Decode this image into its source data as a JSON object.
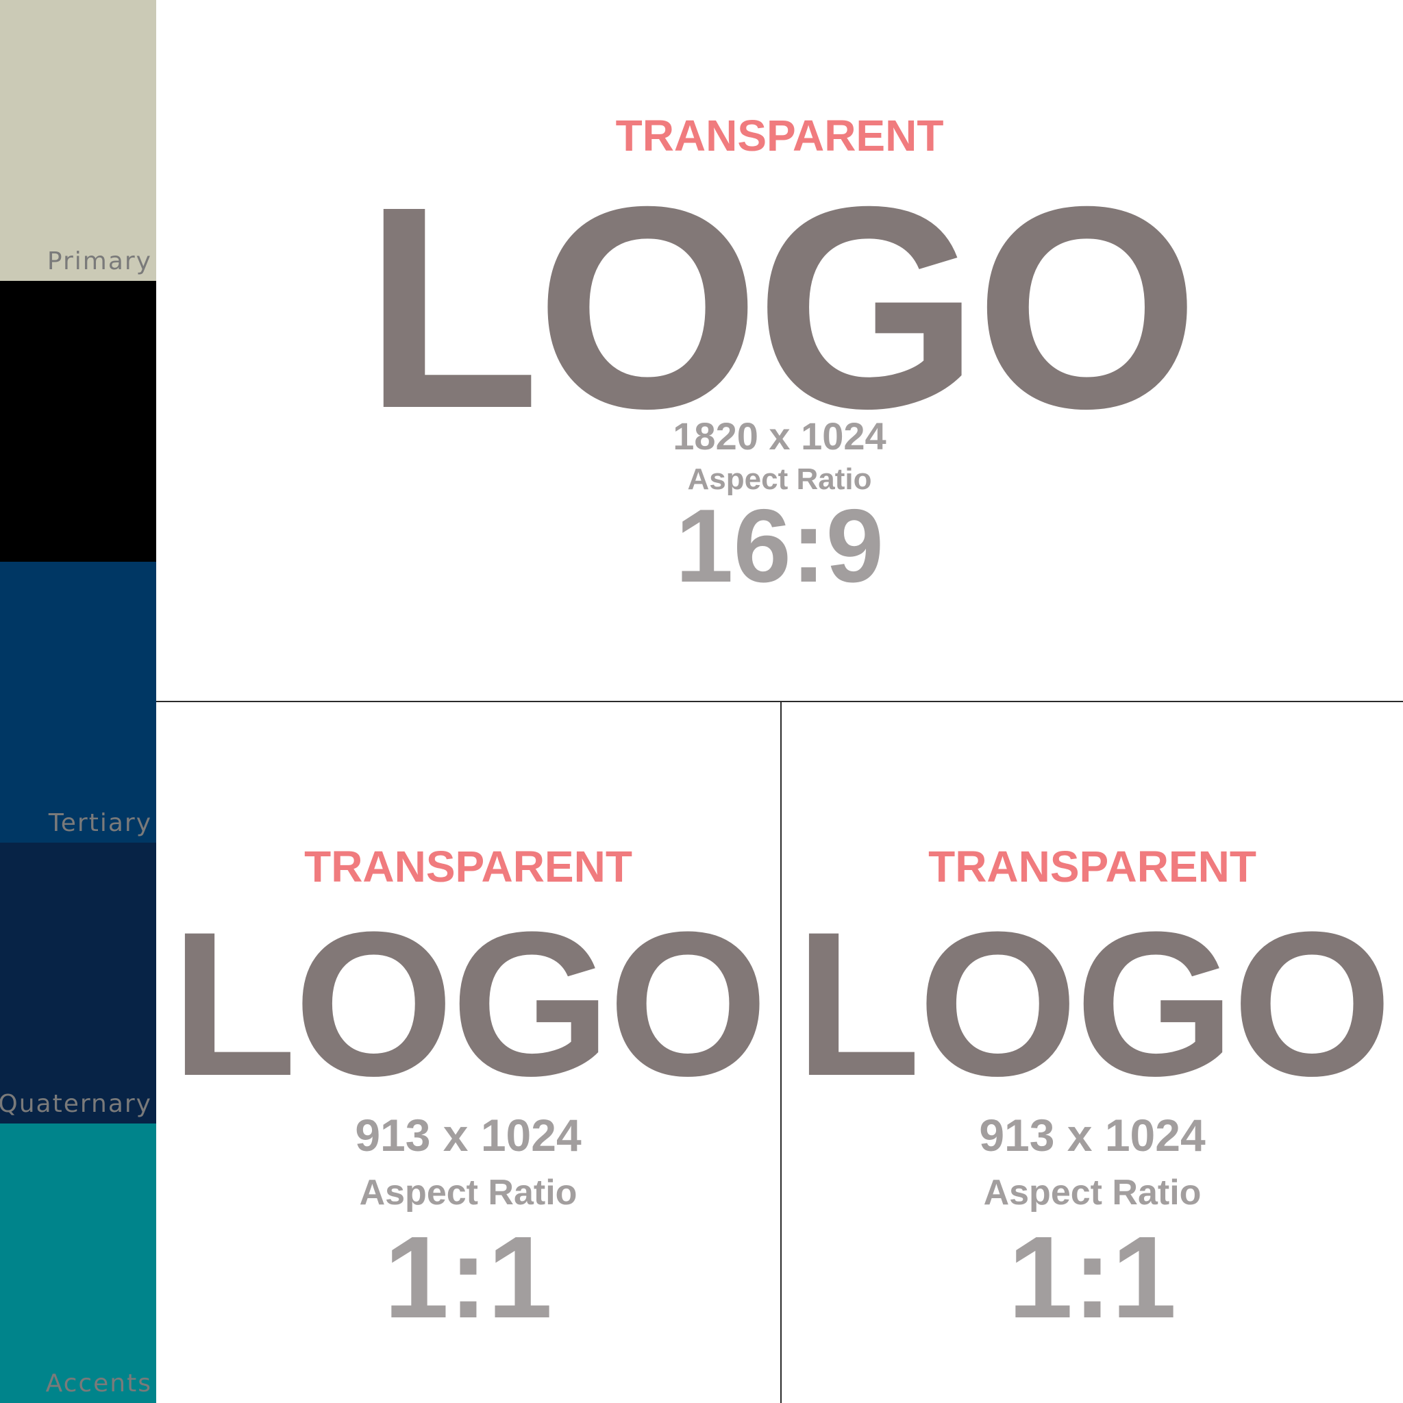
{
  "swatches": [
    {
      "label": "Primary",
      "color": "#cbcab6"
    },
    {
      "label": "",
      "color": "#000000"
    },
    {
      "label": "Tertiary",
      "color": "#003764"
    },
    {
      "label": "Quaternary",
      "color": "#072346"
    },
    {
      "label": "Accents",
      "color": "#00848b"
    }
  ],
  "panels": {
    "wide": {
      "badge": "TRANSPARENT",
      "logo": "LOGO",
      "dimensions": "1820 x 1024",
      "ratio_label": "Aspect Ratio",
      "ratio": "16:9"
    },
    "square_left": {
      "badge": "TRANSPARENT",
      "logo": "LOGO",
      "dimensions": "913 x 1024",
      "ratio_label": "Aspect Ratio",
      "ratio": "1:1"
    },
    "square_right": {
      "badge": "TRANSPARENT",
      "logo": "LOGO",
      "dimensions": "913 x 1024",
      "ratio_label": "Aspect Ratio",
      "ratio": "1:1"
    }
  }
}
